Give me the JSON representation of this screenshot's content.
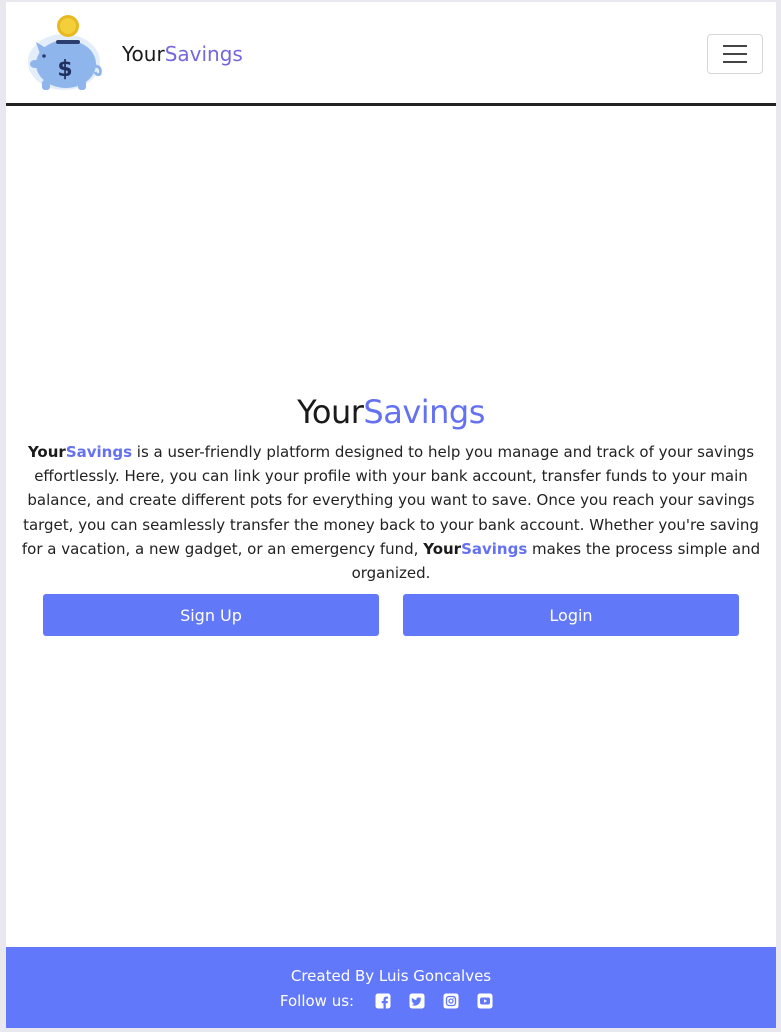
{
  "header": {
    "brand_part1": "Your",
    "brand_part2": "Savings",
    "menu_icon": "hamburger-menu-icon"
  },
  "hero": {
    "title_part1": "Your",
    "title_part2": "Savings",
    "desc_brand1_part1": "Your",
    "desc_brand1_part2": "Savings",
    "desc_text1": " is a user-friendly platform designed to help you manage and track of your savings effortlessly. Here, you can link your profile with your bank account, transfer funds to your main balance, and create different pots for everything you want to save. Once you reach your savings target, you can seamlessly transfer the money back to your bank account. Whether you're saving for a vacation, a new gadget, or an emergency fund, ",
    "desc_brand2_part1": "Your",
    "desc_brand2_part2": "Savings",
    "desc_text2": " makes the process simple and organized."
  },
  "buttons": {
    "signup_label": "Sign Up",
    "login_label": "Login"
  },
  "footer": {
    "credit": "Created By Luis Goncalves",
    "follow_label": "Follow us:",
    "socials": [
      "facebook-icon",
      "twitter-icon",
      "instagram-icon",
      "youtube-icon"
    ]
  },
  "colors": {
    "accent": "#6471f0",
    "button": "#6178f8",
    "footer": "#6278fb",
    "header_border": "#222222"
  }
}
